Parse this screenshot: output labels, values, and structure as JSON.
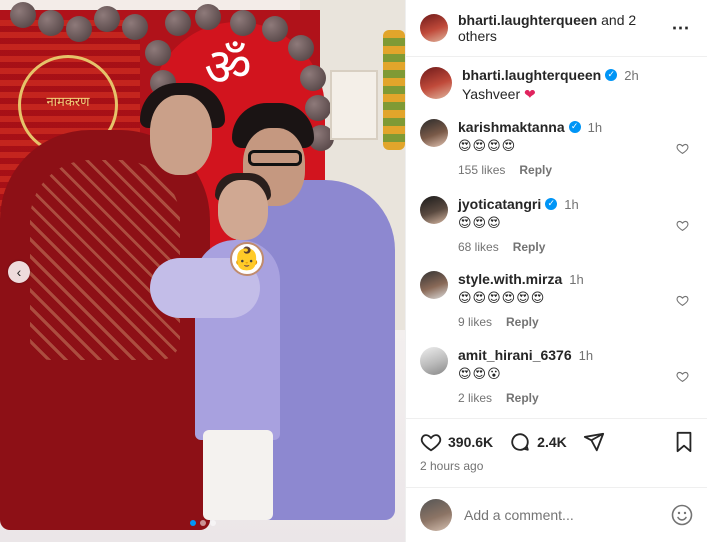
{
  "post": {
    "header_username": "bharti.laughterqueen",
    "header_others": "and 2 others",
    "more_icon": "more-horizontal-icon"
  },
  "caption": {
    "username": "bharti.laughterqueen",
    "time": "2h",
    "text": "Yashveer",
    "emoji": "❤"
  },
  "comments": [
    {
      "username": "karishmaktanna",
      "verified": true,
      "time": "1h",
      "text": "😍😍😍😍",
      "likes": "155 likes",
      "reply": "Reply"
    },
    {
      "username": "jyoticatangri",
      "verified": true,
      "time": "1h",
      "text": "😍😍😍",
      "likes": "68 likes",
      "reply": "Reply"
    },
    {
      "username": "style.with.mirza",
      "verified": false,
      "time": "1h",
      "text": "😍😍😍😍😍😍",
      "likes": "9 likes",
      "reply": "Reply"
    },
    {
      "username": "amit_hirani_6376",
      "verified": false,
      "time": "1h",
      "text": "😍😍😮",
      "likes": "2 likes",
      "reply": "Reply"
    }
  ],
  "actions": {
    "like_count": "390.6K",
    "comment_count": "2.4K",
    "posted": "2 hours ago"
  },
  "composer": {
    "placeholder": "Add a comment..."
  },
  "photo": {
    "ring_text": "नामकरण",
    "om": "ॐ",
    "carousel_total": 3,
    "carousel_active": 1
  },
  "colors": {
    "verified": "#0095f6",
    "heart": "#e0245e",
    "muted": "#737373",
    "text": "#262626"
  }
}
